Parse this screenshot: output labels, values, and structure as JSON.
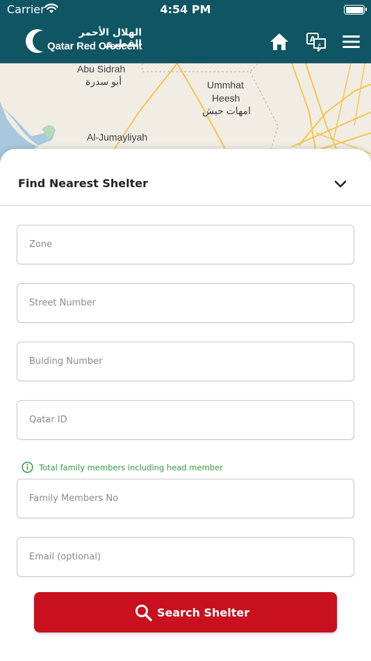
{
  "status_bar": {
    "carrier": "Carrier",
    "time": "4:54 PM"
  },
  "header": {
    "logo_arabic": "الهلال الأحمر القطري",
    "logo_english": "Qatar Red Crescent",
    "background_color": "#0f5563",
    "icons": [
      "home-icon",
      "language-icon",
      "hamburger-menu-icon"
    ]
  },
  "map": {
    "labels": [
      {
        "id": "abu-sidrah-en",
        "text": "Abu Sidrah"
      },
      {
        "id": "abu-sidrah-ar",
        "text": "أبو سدرة"
      },
      {
        "id": "ummhat-en-1",
        "text": "Ummhat"
      },
      {
        "id": "ummhat-en-2",
        "text": "Heesh"
      },
      {
        "id": "ummhat-ar",
        "text": "امهات حيش"
      },
      {
        "id": "jumayliyah-en",
        "text": "Al-Jumayliyah"
      }
    ]
  },
  "form": {
    "title": "Find Nearest Shelter",
    "fields": {
      "zone": {
        "placeholder": "Zone",
        "value": ""
      },
      "street": {
        "placeholder": "Street Number",
        "value": ""
      },
      "building": {
        "placeholder": "Bulding Number",
        "value": ""
      },
      "qatar_id": {
        "placeholder": "Qatar ID",
        "value": ""
      },
      "family": {
        "placeholder": "Family Members No",
        "value": ""
      },
      "email": {
        "placeholder": "Email (optional)",
        "value": ""
      }
    },
    "family_hint": "Total family members including head member",
    "hint_color": "#2e9a3c",
    "submit_label": "Search Shelter",
    "submit_color": "#c8101e"
  }
}
